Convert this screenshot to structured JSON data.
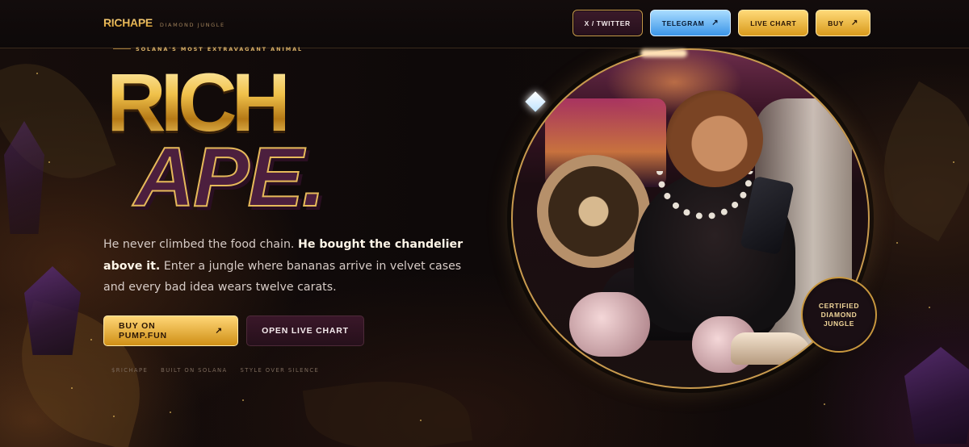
{
  "header": {
    "brand": "RICHAPE",
    "tagline": "DIAMOND JUNGLE",
    "nav": [
      {
        "label": "X / TWITTER",
        "arrow": ""
      },
      {
        "label": "TELEGRAM",
        "arrow": "↗"
      },
      {
        "label": "LIVE CHART",
        "arrow": ""
      },
      {
        "label": "BUY",
        "arrow": "↗"
      }
    ]
  },
  "hero": {
    "eyebrow": "SOLANA'S MOST EXTRAVAGANT ANIMAL",
    "title_line1": "RICH",
    "title_line2": "APE.",
    "lede_part1": "He never climbed the food chain. ",
    "lede_bold": "He bought the chandelier above it.",
    "lede_part2": " Enter a jungle where bananas arrive in velvet cases and every bad idea wears twelve carats.",
    "cta_primary": "BUY ON PUMP.FUN",
    "cta_primary_arrow": "↗",
    "cta_secondary": "OPEN LIVE CHART",
    "tags": [
      "$RICHAPE",
      "BUILT ON SOLANA",
      "STYLE OVER SILENCE"
    ],
    "badge": "CERTIFIED\nDIAMOND\nJUNGLE"
  },
  "colors": {
    "gold": "#e9b84a",
    "plum": "#4c1f3e",
    "telegram_blue": "#3b95e8",
    "background": "#0b0708"
  }
}
